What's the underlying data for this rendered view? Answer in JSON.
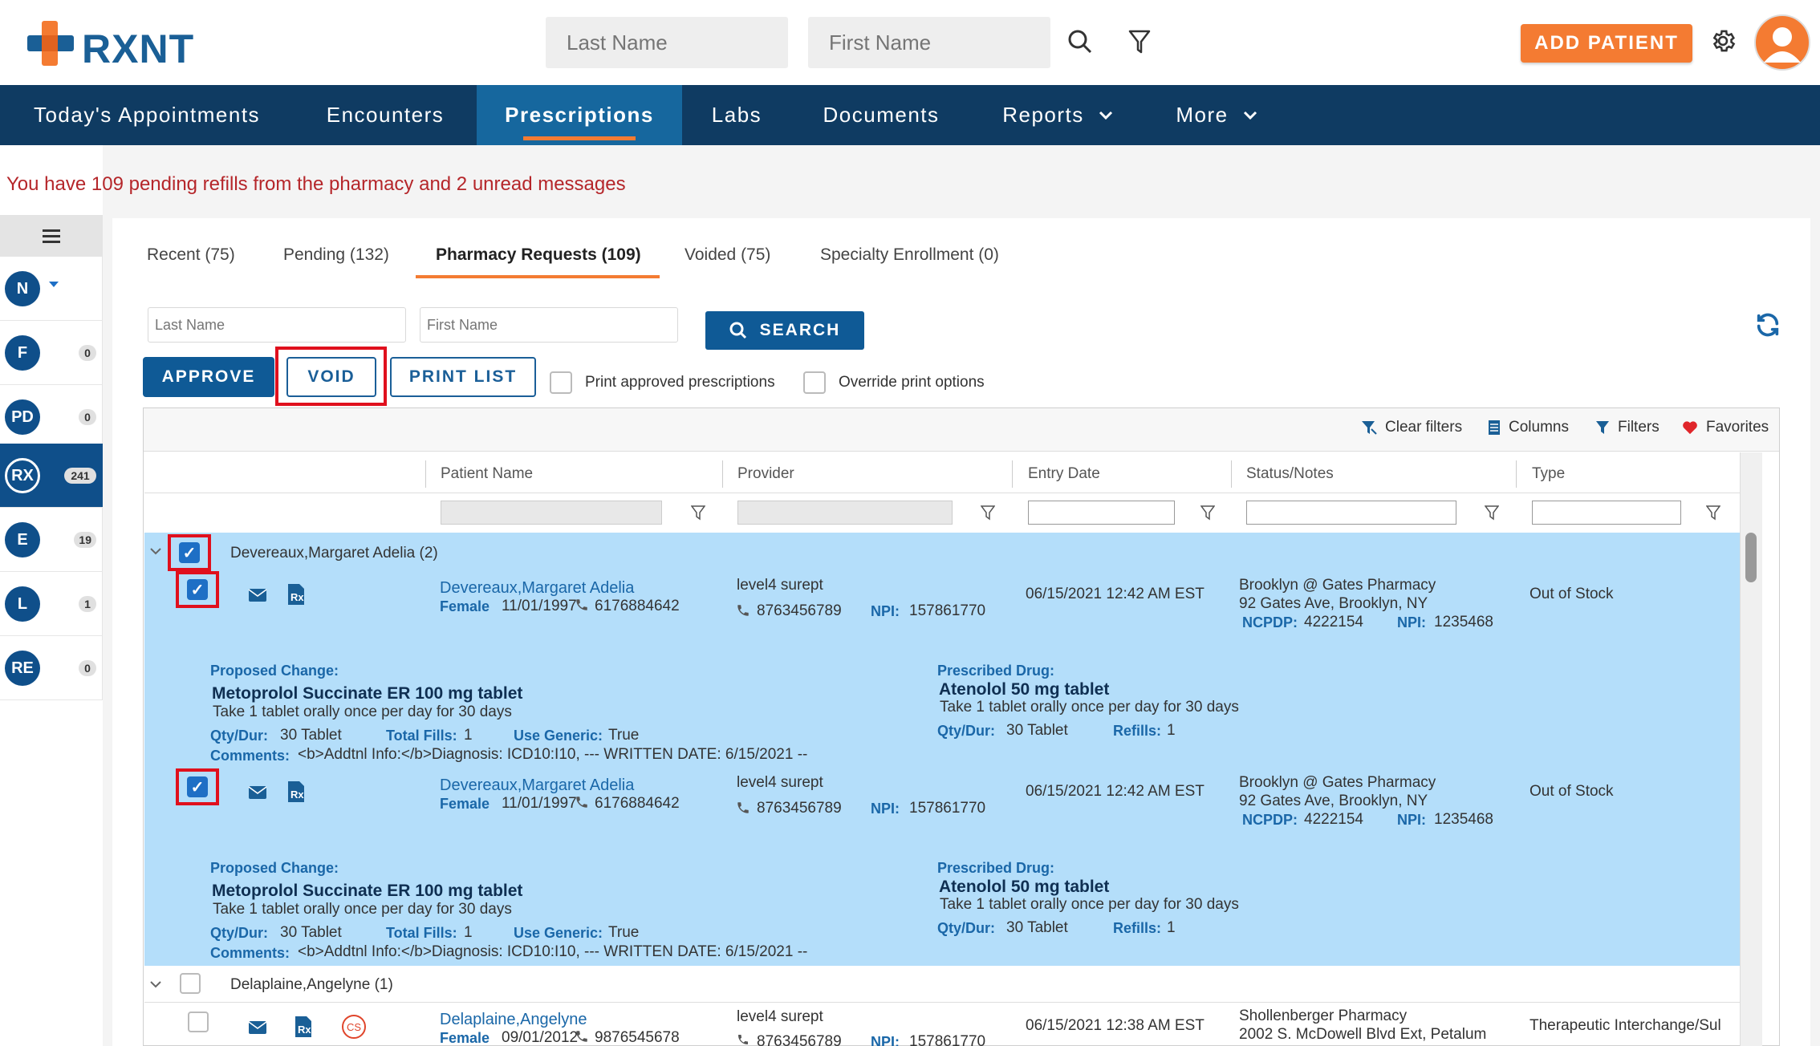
{
  "brand": {
    "name": "RXNT"
  },
  "header": {
    "last_name_placeholder": "Last Name",
    "first_name_placeholder": "First Name",
    "add_patient_label": "ADD PATIENT"
  },
  "nav": {
    "items": [
      "Today's Appointments",
      "Encounters",
      "Prescriptions",
      "Labs",
      "Documents",
      "Reports",
      "More"
    ],
    "active": "Prescriptions"
  },
  "alert": {
    "text": "You have 109 pending refills from the pharmacy  and 2 unread messages"
  },
  "sidebar": {
    "items": [
      {
        "label": "N",
        "badge": ""
      },
      {
        "label": "F",
        "badge": "0"
      },
      {
        "label": "PD",
        "badge": "0"
      },
      {
        "label": "RX",
        "badge": "241"
      },
      {
        "label": "E",
        "badge": "19"
      },
      {
        "label": "L",
        "badge": "1"
      },
      {
        "label": "RE",
        "badge": "0"
      }
    ]
  },
  "tabs": [
    "Recent (75)",
    "Pending (132)",
    "Pharmacy Requests (109)",
    "Voided (75)",
    "Specialty Enrollment (0)"
  ],
  "search": {
    "last_name_placeholder": "Last Name",
    "first_name_placeholder": "First Name",
    "button": "SEARCH"
  },
  "actions": {
    "approve": "APPROVE",
    "void": "VOID",
    "print_list": "PRINT LIST",
    "print_approved": "Print approved prescriptions",
    "override_print": "Override print options"
  },
  "toolbar": {
    "clear_filters": "Clear filters",
    "columns": "Columns",
    "filters": "Filters",
    "favorites": "Favorites"
  },
  "columns": [
    "Patient Name",
    "Provider",
    "Entry Date",
    "Status/Notes",
    "Type"
  ],
  "groups": [
    {
      "title": "Devereaux,Margaret Adelia (2)"
    },
    {
      "title": "Delaplaine,Angelyne (1)"
    }
  ],
  "rows": [
    {
      "patient": "Devereaux,Margaret Adelia",
      "gender": "Female",
      "dob": "11/01/1997",
      "phone": "6176884642",
      "provider": "level4 surept",
      "provider_phone": "8763456789",
      "npi_label": "NPI:",
      "npi": "157861770",
      "entry_date": "06/15/2021 12:42 AM EST",
      "pharmacy": "Brooklyn @ Gates Pharmacy",
      "address": "92 Gates Ave, Brooklyn, NY",
      "ncpdp_label": "NCPDP:",
      "ncpdp": "4222154",
      "pharm_npi_label": "NPI:",
      "pharm_npi": "1235468",
      "type": "Out of Stock",
      "proposed_label": "Proposed Change:",
      "proposed_drug": "Metoprolol Succinate ER 100 mg tablet",
      "proposed_sig": "Take 1 tablet orally once per day for 30 days",
      "qty_label": "Qty/Dur:",
      "qty": "30 Tablet",
      "fills_label": "Total Fills:",
      "fills": "1",
      "generic_label": "Use Generic:",
      "generic": "True",
      "comments_label": "Comments:",
      "comments": "<b>Addtnl Info:</b>Diagnosis: ICD10:I10, --- WRITTEN DATE: 6/15/2021 --",
      "prescribed_label": "Prescribed Drug:",
      "prescribed_drug": "Atenolol 50 mg tablet",
      "prescribed_sig": "Take 1 tablet orally once per day for 30 days",
      "pqty_label": "Qty/Dur:",
      "pqty": "30 Tablet",
      "refills_label": "Refills:",
      "refills": "1"
    },
    {
      "patient": "Devereaux,Margaret Adelia",
      "gender": "Female",
      "dob": "11/01/1997",
      "phone": "6176884642",
      "provider": "level4 surept",
      "provider_phone": "8763456789",
      "npi_label": "NPI:",
      "npi": "157861770",
      "entry_date": "06/15/2021 12:42 AM EST",
      "pharmacy": "Brooklyn @ Gates Pharmacy",
      "address": "92 Gates Ave, Brooklyn, NY",
      "ncpdp_label": "NCPDP:",
      "ncpdp": "4222154",
      "pharm_npi_label": "NPI:",
      "pharm_npi": "1235468",
      "type": "Out of Stock",
      "proposed_label": "Proposed Change:",
      "proposed_drug": "Metoprolol Succinate ER 100 mg tablet",
      "proposed_sig": "Take 1 tablet orally once per day for 30 days",
      "qty_label": "Qty/Dur:",
      "qty": "30 Tablet",
      "fills_label": "Total Fills:",
      "fills": "1",
      "generic_label": "Use Generic:",
      "generic": "True",
      "comments_label": "Comments:",
      "comments": "<b>Addtnl Info:</b>Diagnosis: ICD10:I10, --- WRITTEN DATE: 6/15/2021 --",
      "prescribed_label": "Prescribed Drug:",
      "prescribed_drug": "Atenolol 50 mg tablet",
      "prescribed_sig": "Take 1 tablet orally once per day for 30 days",
      "pqty_label": "Qty/Dur:",
      "pqty": "30 Tablet",
      "refills_label": "Refills:",
      "refills": "1"
    },
    {
      "patient": "Delaplaine,Angelyne",
      "gender": "Female",
      "dob": "09/01/2012",
      "phone": "9876545678",
      "provider": "level4 surept",
      "provider_phone": "8763456789",
      "npi_label": "NPI:",
      "npi": "157861770",
      "entry_date": "06/15/2021 12:38 AM EST",
      "pharmacy": "Shollenberger Pharmacy",
      "address": "2002 S. McDowell Blvd Ext, Petalum",
      "type": "Therapeutic Interchange/Sul",
      "cs_badge": "CS"
    }
  ],
  "colors": {
    "brand": "#1a5f96",
    "accent": "#f47b32",
    "nav": "#0f3b62",
    "highlight": "#b4defa",
    "alert": "#b5262a"
  },
  "icons": [
    "search-icon",
    "filter-icon",
    "gear-icon",
    "avatar-icon",
    "hamburger-icon",
    "refresh-icon",
    "envelope-icon",
    "rx-document-icon",
    "phone-icon",
    "heart-icon",
    "columns-icon",
    "chevron-down-icon"
  ]
}
